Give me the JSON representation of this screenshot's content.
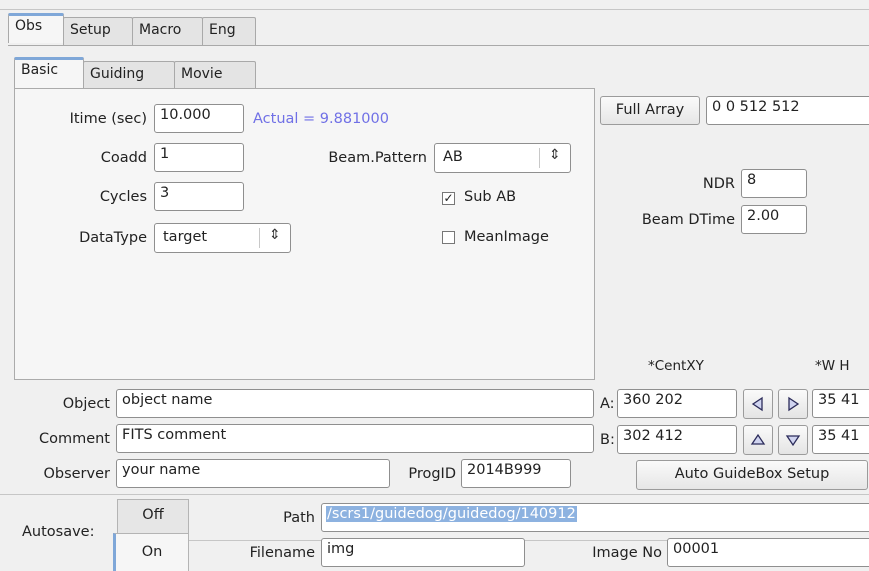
{
  "top_tabs": [
    "Obs",
    "Setup",
    "Macro",
    "Eng"
  ],
  "sub_tabs": [
    "Basic",
    "Guiding",
    "Movie"
  ],
  "basic": {
    "itime_label": "Itime (sec)",
    "itime_value": "10.000",
    "actual_text": "Actual = 9.881000",
    "coadd_label": "Coadd",
    "coadd_value": "1",
    "cycles_label": "Cycles",
    "cycles_value": "3",
    "datatype_label": "DataType",
    "datatype_value": "target",
    "beam_pattern_label": "Beam.Pattern",
    "beam_pattern_value": "AB",
    "sub_ab_label": "Sub AB",
    "sub_ab_checked": true,
    "meanimage_label": "MeanImage",
    "meanimage_checked": false
  },
  "array": {
    "full_array_label": "Full Array",
    "full_array_value": "0 0 512 512",
    "ndr_label": "NDR",
    "ndr_value": "8",
    "beam_dtime_label": "Beam DTime",
    "beam_dtime_value": "2.00"
  },
  "guidebox": {
    "centxy_header": "*CentXY",
    "wh_header": "*W H",
    "a_label": "A:",
    "a_cent": "360 202",
    "a_wh": "35 41",
    "b_label": "B:",
    "b_cent": "302 412",
    "b_wh": "35 41",
    "auto_button": "Auto GuideBox Setup"
  },
  "meta": {
    "object_label": "Object",
    "object_value": "object name",
    "comment_label": "Comment",
    "comment_value": "FITS comment",
    "observer_label": "Observer",
    "observer_value": "your name",
    "progid_label": "ProgID",
    "progid_value": "2014B999"
  },
  "autosave": {
    "label": "Autosave:",
    "off_label": "Off",
    "on_label": "On",
    "path_label": "Path",
    "path_value": "/scrs1/guidedog/guidedog/140912",
    "filename_label": "Filename",
    "filename_value": "img",
    "imageno_label": "Image No",
    "imageno_value": "00001"
  }
}
